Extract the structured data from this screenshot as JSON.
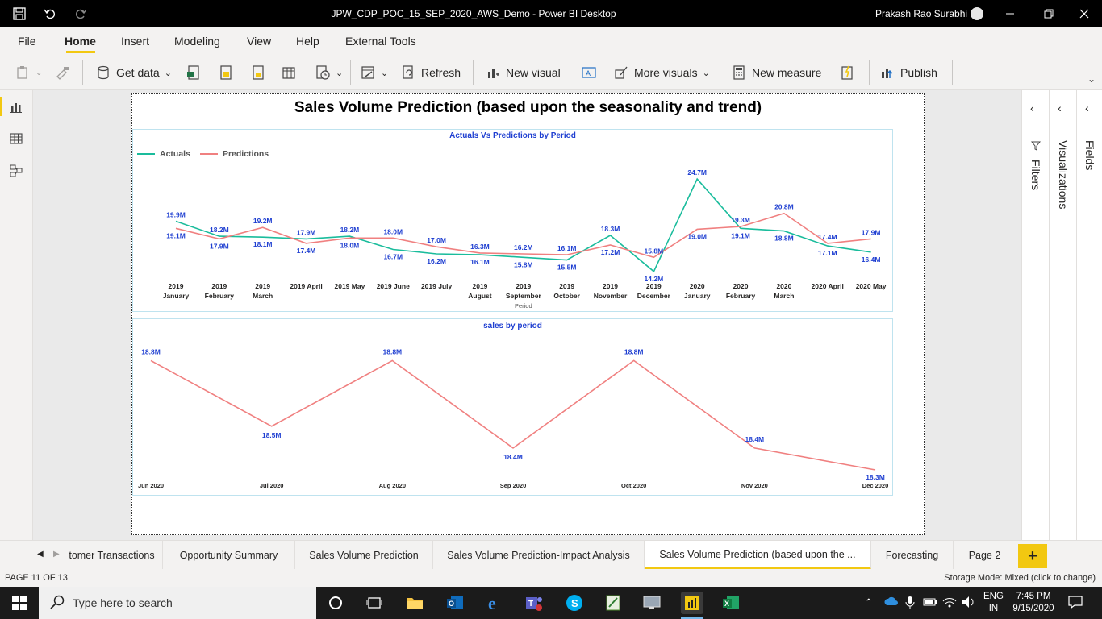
{
  "window": {
    "title": "JPW_CDP_POC_15_SEP_2020_AWS_Demo - Power BI Desktop",
    "user": "Prakash Rao Surabhi"
  },
  "menu": [
    "File",
    "Home",
    "Insert",
    "Modeling",
    "View",
    "Help",
    "External Tools"
  ],
  "ribbon": {
    "get_data": "Get data",
    "refresh": "Refresh",
    "new_visual": "New visual",
    "more_visuals": "More visuals",
    "new_measure": "New measure",
    "publish": "Publish"
  },
  "report": {
    "title": "Sales Volume Prediction (based upon the seasonality and trend)"
  },
  "panes": {
    "filters": "Filters",
    "visualizations": "Visualizations",
    "fields": "Fields"
  },
  "colors": {
    "actuals": "#1abc9c",
    "predictions": "#f08080",
    "label": "#1f3fd1",
    "accent": "#f2c811"
  },
  "chart_data": [
    {
      "type": "line",
      "title": "Actuals Vs Predictions by Period",
      "xlabel": "Period",
      "x": [
        "2019 January",
        "2019 February",
        "2019 March",
        "2019 April",
        "2019 May",
        "2019 June",
        "2019 July",
        "2019 August",
        "2019 September",
        "2019 October",
        "2019 November",
        "2019 December",
        "2020 January",
        "2020 February",
        "2020 March",
        "2020 April",
        "2020 May"
      ],
      "x_lines": [
        [
          "2019",
          "January"
        ],
        [
          "2019",
          "February"
        ],
        [
          "2019",
          "March"
        ],
        [
          "2019 April"
        ],
        [
          "2019 May"
        ],
        [
          "2019 June"
        ],
        [
          "2019 July"
        ],
        [
          "2019",
          "August"
        ],
        [
          "2019",
          "September"
        ],
        [
          "2019",
          "October"
        ],
        [
          "2019",
          "November"
        ],
        [
          "2019",
          "December"
        ],
        [
          "2020",
          "January"
        ],
        [
          "2020",
          "February"
        ],
        [
          "2020",
          "March"
        ],
        [
          "2020 April"
        ],
        [
          "2020 May"
        ]
      ],
      "series": [
        {
          "name": "Actuals",
          "values": [
            19.9,
            18.2,
            18.1,
            17.9,
            18.2,
            16.7,
            16.2,
            16.1,
            15.8,
            15.5,
            18.3,
            14.2,
            24.7,
            19.1,
            18.8,
            17.1,
            16.4
          ],
          "labels": [
            "19.9M",
            "18.2M",
            "18.1M",
            "17.9M",
            "18.2M",
            "16.7M",
            "16.2M",
            "16.1M",
            "15.8M",
            "15.5M",
            "18.3M",
            "14.2M",
            "24.7M",
            "19.1M",
            "18.8M",
            "17.1M",
            "16.4M"
          ]
        },
        {
          "name": "Predictions",
          "values": [
            19.1,
            17.9,
            19.2,
            17.4,
            18.0,
            18.0,
            17.0,
            16.3,
            16.2,
            16.1,
            17.2,
            15.8,
            19.0,
            19.3,
            20.8,
            17.4,
            17.9
          ],
          "labels": [
            "19.1M",
            "17.9M",
            "19.2M",
            "17.4M",
            "18.0M",
            "18.0M",
            "17.0M",
            "16.3M",
            "16.2M",
            "16.1M",
            "17.2M",
            "15.8M",
            "19.0M",
            "19.3M",
            "20.8M",
            "17.4M",
            "17.9M"
          ]
        }
      ],
      "legend": "top-left",
      "grid": false
    },
    {
      "type": "line",
      "title": "sales by period",
      "x": [
        "Jun 2020",
        "Jul 2020",
        "Aug 2020",
        "Sep 2020",
        "Oct 2020",
        "Nov 2020",
        "Dec 2020"
      ],
      "series": [
        {
          "values": [
            18.8,
            18.5,
            18.8,
            18.4,
            18.8,
            18.4,
            18.3
          ],
          "labels": [
            "18.8M",
            "18.5M",
            "18.8M",
            "18.4M",
            "18.8M",
            "18.4M",
            "18.3M"
          ]
        }
      ],
      "grid": false
    }
  ],
  "tabs": {
    "items": [
      "tomer Transactions",
      "Opportunity Summary",
      "Sales Volume Prediction",
      "Sales Volume Prediction-Impact Analysis",
      "Sales Volume Prediction (based upon the ...",
      "Forecasting",
      "Page 2"
    ],
    "active_index": 4,
    "add": "+"
  },
  "status": {
    "page": "PAGE 11 OF 13",
    "storage": "Storage Mode: Mixed (click to change)"
  },
  "taskbar": {
    "search_placeholder": "Type here to search",
    "lang_top": "ENG",
    "lang_bottom": "IN",
    "time": "7:45 PM",
    "date": "9/15/2020"
  }
}
